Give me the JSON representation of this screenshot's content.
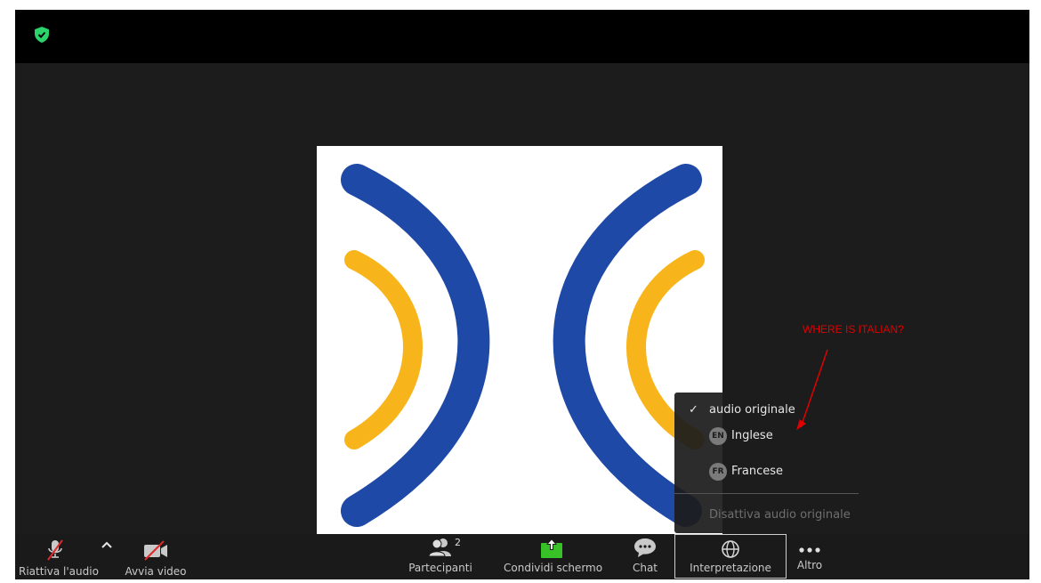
{
  "toolbar": {
    "unmute_label": "Riattiva l'audio",
    "video_label": "Avvia video",
    "participants_label": "Partecipanti",
    "participants_count": "2",
    "share_label": "Condividi schermo",
    "chat_label": "Chat",
    "interpretation_label": "Interpretazione",
    "more_label": "Altro"
  },
  "interpretation_menu": {
    "original_audio": "audio originale",
    "languages": [
      {
        "code": "EN",
        "name": "Inglese"
      },
      {
        "code": "FR",
        "name": "Francese"
      }
    ],
    "mute_original": "Disattiva audio originale"
  },
  "annotation": {
    "text": "WHERE IS ITALIAN?"
  },
  "colors": {
    "logo_blue": "#1f49a6",
    "logo_yellow": "#f7b51b",
    "share_green": "#37c228",
    "annotation_red": "#e00000",
    "shield_green": "#2bd46a"
  },
  "icons": {
    "shield": "shield-check-icon",
    "mic": "mic-muted-icon",
    "video": "video-off-icon",
    "participants": "participants-icon",
    "share": "share-screen-icon",
    "chat": "chat-bubble-icon",
    "interpretation": "globe-icon",
    "more": "more-dots-icon"
  }
}
